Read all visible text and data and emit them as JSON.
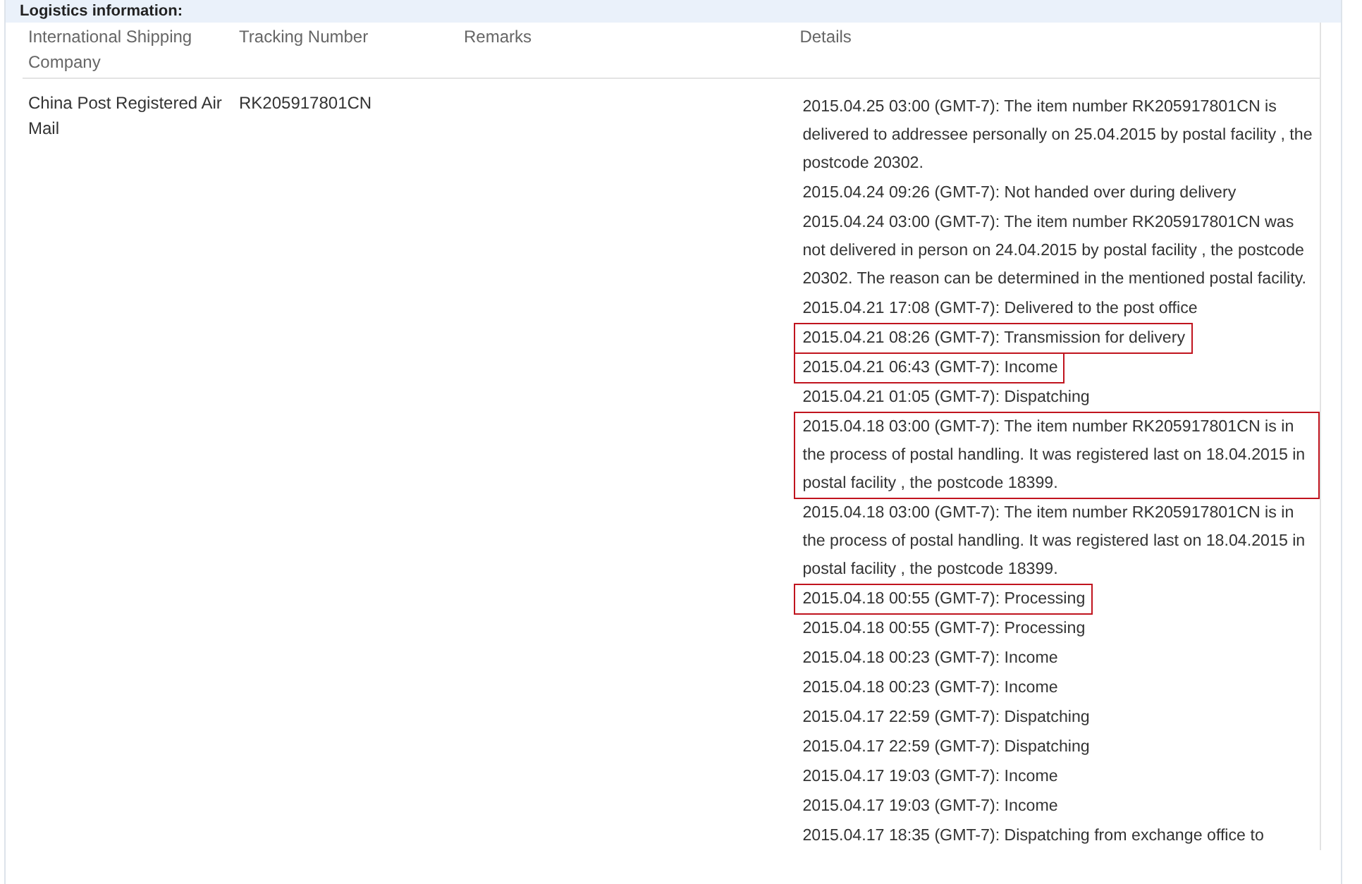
{
  "section_title": "Logistics information:",
  "table": {
    "columns": [
      "International Shipping Company",
      "Tracking Number",
      "Remarks",
      "Details"
    ],
    "rows": [
      {
        "company": "China Post Registered Air Mail",
        "tracking_number": "RK205917801CN",
        "details": [
          {
            "text": "2015.04.25 03:00 (GMT-7): The item number RK205917801CN is delivered to addressee personally on 25.04.2015 by postal facility , the postcode 20302.",
            "highlighted": false
          },
          {
            "text": "2015.04.24 09:26 (GMT-7): Not handed over during delivery",
            "highlighted": false
          },
          {
            "text": "2015.04.24 03:00 (GMT-7): The item number RK205917801CN was not delivered in person on 24.04.2015 by postal facility , the postcode 20302. The reason can be determined in the mentioned postal facility.",
            "highlighted": false
          },
          {
            "text": "2015.04.21 17:08 (GMT-7): Delivered to the post office",
            "highlighted": false
          },
          {
            "text": "2015.04.21 08:26 (GMT-7): Transmission for delivery",
            "highlighted": true
          },
          {
            "text": "2015.04.21 06:43 (GMT-7): Income",
            "highlighted": true
          },
          {
            "text": "2015.04.21 01:05 (GMT-7): Dispatching",
            "highlighted": false
          },
          {
            "text": "2015.04.18 03:00 (GMT-7): The item number RK205917801CN is in the process of postal handling. It was registered last on 18.04.2015 in postal facility , the postcode 18399.",
            "highlighted": true
          },
          {
            "text": "2015.04.18 03:00 (GMT-7): The item number RK205917801CN is in the process of postal handling. It was registered last on 18.04.2015 in postal facility , the postcode 18399.",
            "highlighted": false
          },
          {
            "text": "2015.04.18 00:55 (GMT-7): Processing",
            "highlighted": true
          },
          {
            "text": "2015.04.18 00:55 (GMT-7): Processing",
            "highlighted": false
          },
          {
            "text": "2015.04.18 00:23 (GMT-7): Income",
            "highlighted": false
          },
          {
            "text": "2015.04.18 00:23 (GMT-7): Income",
            "highlighted": false
          },
          {
            "text": "2015.04.17 22:59 (GMT-7): Dispatching",
            "highlighted": false
          },
          {
            "text": "2015.04.17 22:59 (GMT-7): Dispatching",
            "highlighted": false
          },
          {
            "text": "2015.04.17 19:03 (GMT-7): Income",
            "highlighted": false
          },
          {
            "text": "2015.04.17 19:03 (GMT-7): Income",
            "highlighted": false
          },
          {
            "text": "2015.04.17 18:35 (GMT-7): Dispatching from exchange office to",
            "highlighted": false
          }
        ]
      }
    ]
  }
}
